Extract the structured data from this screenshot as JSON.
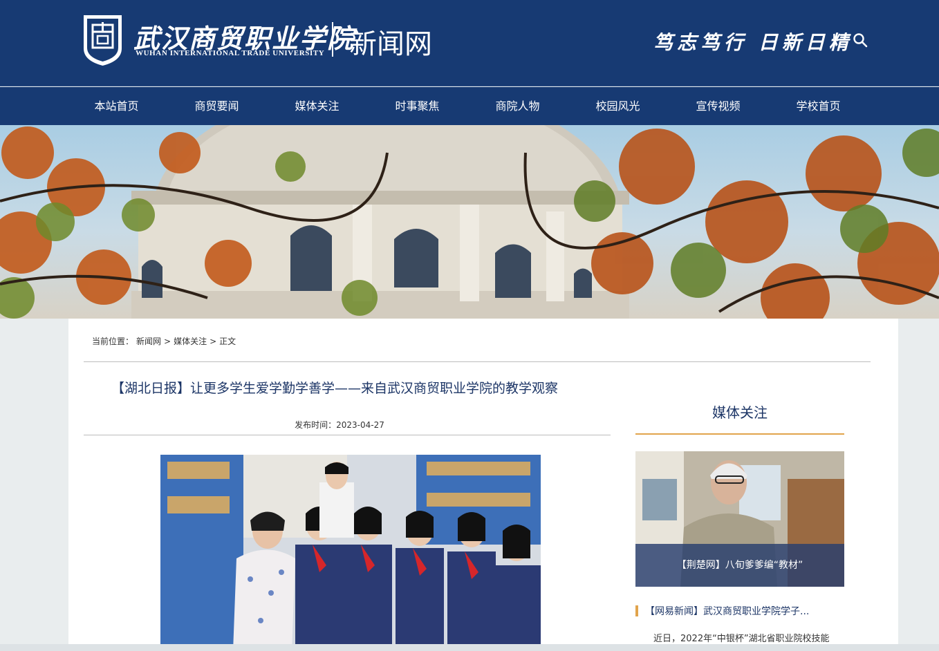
{
  "header": {
    "school_name_cn": "武汉商贸职业学院",
    "school_name_en": "WUHAN INTERNATIONAL TRADE UNIVERSITY",
    "site_name": "新闻网",
    "motto": "笃志笃行 日新日精",
    "logo_icon": "school-emblem-icon",
    "search_icon": "search-icon",
    "brand_color": "#173a73"
  },
  "nav": {
    "items": [
      {
        "label": "本站首页"
      },
      {
        "label": "商贸要闻"
      },
      {
        "label": "媒体关注"
      },
      {
        "label": "时事聚焦"
      },
      {
        "label": "商院人物"
      },
      {
        "label": "校园风光"
      },
      {
        "label": "宣传视频"
      },
      {
        "label": "学校首页"
      }
    ]
  },
  "breadcrumb": {
    "prefix": "当前位置：",
    "items": [
      "新闻网",
      "媒体关注",
      "正文"
    ],
    "separator": ">"
  },
  "article": {
    "title": "【湖北日报】让更多学生爱学勤学善学——来自武汉商贸职业学院的教学观察",
    "date_label": "发布时间：",
    "date": "2023-04-27"
  },
  "sidebar": {
    "title": "媒体关注",
    "feature_caption": "【荆楚网】八旬爹爹编“教材”",
    "item_title": "【网易新闻】武汉商贸职业学院学子...",
    "item_summary": "近日，2022年“中银杯”湖北省职业院校技能",
    "accent_color": "#e1a44c"
  }
}
